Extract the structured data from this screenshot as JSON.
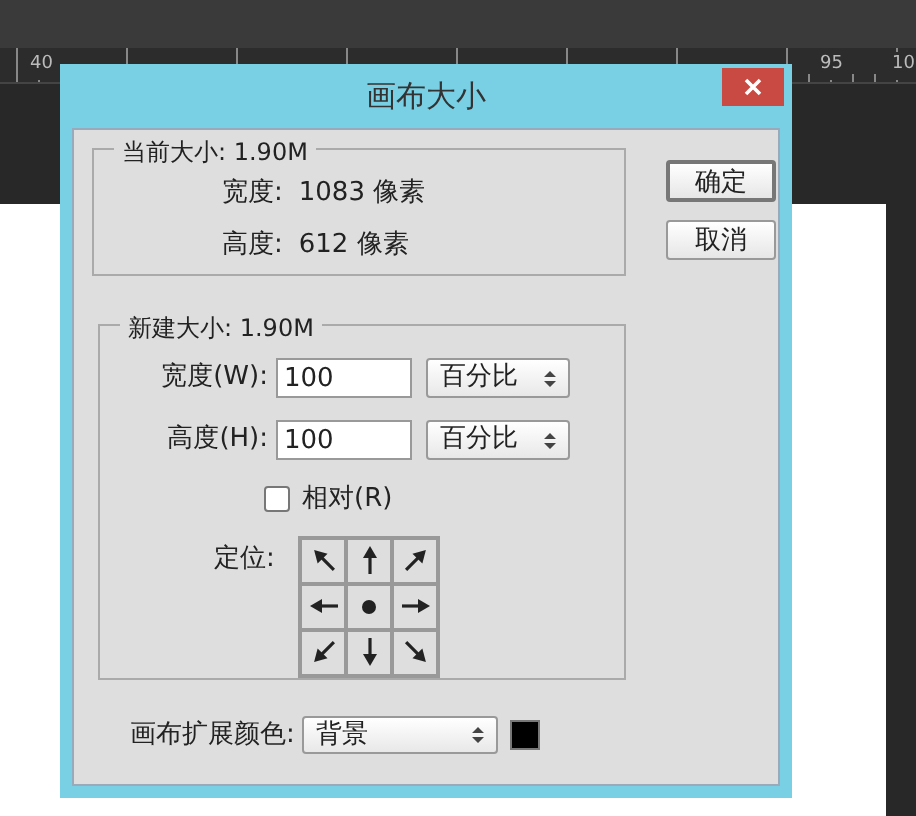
{
  "ruler": {
    "labels": [
      "40",
      "95",
      "10"
    ]
  },
  "dialog": {
    "title": "画布大小",
    "current_size": {
      "legend": "当前大小: 1.90M",
      "rows": [
        {
          "label": "宽度:",
          "value": "1083 像素"
        },
        {
          "label": "高度:",
          "value": "612 像素"
        }
      ]
    },
    "buttons": [
      {
        "label": "确定",
        "default": true
      },
      {
        "label": "取消",
        "default": false
      }
    ],
    "new_size": {
      "legend": "新建大小: 1.90M",
      "fields": [
        {
          "label": "宽度(W):",
          "value": "100",
          "unit": "百分比"
        },
        {
          "label": "高度(H):",
          "value": "100",
          "unit": "百分比"
        }
      ],
      "relative": {
        "label": "相对(R)",
        "checked": false
      },
      "anchor": {
        "label": "定位:"
      }
    },
    "extension_color": {
      "label": "画布扩展颜色:",
      "value": "背景",
      "color": "#000000"
    }
  }
}
